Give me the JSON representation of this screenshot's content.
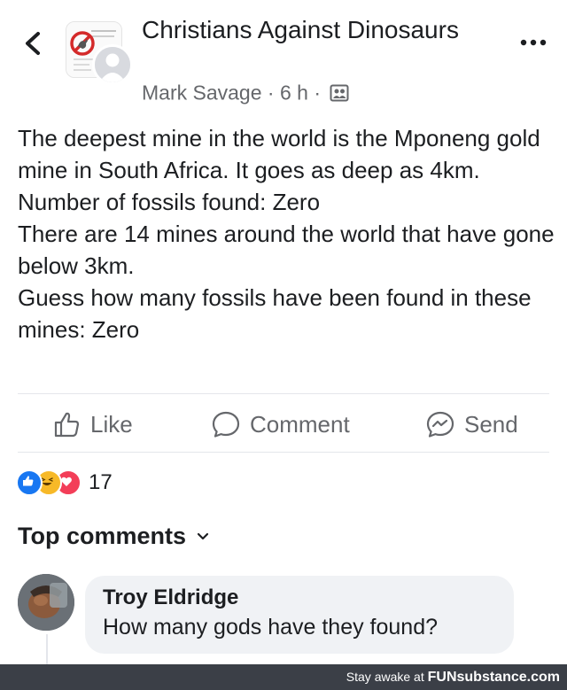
{
  "header": {
    "group_name": "Christians Against Dinosaurs",
    "author": "Mark Savage",
    "separator": "·",
    "time": "6 h",
    "icons": {
      "back": "chevron-left-icon",
      "more": "more-dots-icon",
      "privacy": "group-privacy-icon"
    }
  },
  "post": {
    "lines": [
      "The deepest mine in the world is the Mponeng gold mine in South Africa. It goes as deep as 4km.",
      "Number of fossils found: Zero",
      "There are 14 mines around the world that have gone below 3km.",
      "Guess how many fossils have been found in these mines: Zero"
    ]
  },
  "actions": {
    "like": "Like",
    "comment": "Comment",
    "send": "Send"
  },
  "reactions": {
    "types": [
      "like",
      "haha",
      "love"
    ],
    "count": "17",
    "colors": {
      "like": "#1877f2",
      "haha": "#f7b928",
      "love": "#f33e58"
    }
  },
  "comments": {
    "heading": "Top comments",
    "items": [
      {
        "author": "Troy Eldridge",
        "text": "How many gods have they found?"
      }
    ]
  },
  "watermark": {
    "prefix": "Stay awake at",
    "brand": "FUNsubstance.com"
  }
}
